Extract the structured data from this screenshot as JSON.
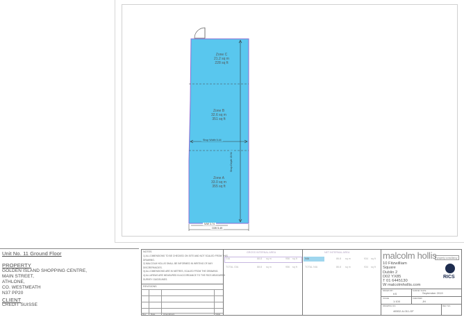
{
  "drawing": {
    "zones": [
      {
        "name": "Zone C",
        "sqm": "21.2 sq m",
        "sqft": "228 sq ft"
      },
      {
        "name": "Zone B",
        "sqm": "32.6 sq m",
        "sqft": "351 sq ft"
      },
      {
        "name": "Zone A",
        "sqm": "33.0 sq m",
        "sqft": "355 sq ft"
      }
    ],
    "shop_width": "Shop Width 5.44",
    "shop_depth": "Shop Depth 15.94",
    "dim_nw": "N/W 3.74",
    "dim_ow": "O/W 5.49"
  },
  "info": {
    "unit": "Unit No. 11 Ground Floor",
    "property_heading": "PROPERTY",
    "property_lines": [
      "GOLDEN ISLAND SHOPPING CENTRE,",
      "MAIN STREET,",
      "ATHLONE,",
      "CO. WESTMEATH",
      "N37 PP20"
    ],
    "client_heading": "CLIENT",
    "client": "CREDIT SUISSE"
  },
  "title_block": {
    "notes_heading": "NOTES",
    "notes": [
      "1) ALL DIMENSIONS TO BE CHECKED ON SITE AND NOT SCALED FROM THIS",
      "DRAWING.",
      "2) MALCOLM HOLLIS SHALL BE INFORMED IN WRITING OF ANY",
      "DISCREPANCIES.",
      "3) ALL DIMENSIONS ARE IN METRES, SCALED FROM THE DRAWING.",
      "4) ALL AREAS ARE MEASURED IN ACCORDANCE TO THE RICS MEASURED",
      "SURVEY GUIDELINES."
    ],
    "revisions_heading": "REVISIONS",
    "rev_cols": [
      "Rev",
      "Date",
      "Amendment",
      "Initial"
    ],
    "gia_heading": "GROSS INTERNAL AREA",
    "nia_heading": "NET INTERNAL AREA",
    "gia_rows": [
      [
        "GIA",
        "88.8",
        "sq m",
        "956",
        "sq ft"
      ],
      [
        "TOTAL GIA",
        "88.8",
        "sq m",
        "956",
        "sq ft"
      ]
    ],
    "nia_rows": [
      [
        "NIA",
        "86.8",
        "sq m",
        "934",
        "sq ft"
      ],
      [
        "TOTAL NIA",
        "86.8",
        "sq m",
        "934",
        "sq ft"
      ]
    ],
    "logo": "malcolm hollis",
    "logo_tag": "property consultancy",
    "address": [
      "10 Fitzwilliam",
      "Square",
      "Dublin 2",
      "D02 YX85"
    ],
    "tel": "T 01 6445130",
    "web": "W malcolmhollis.com",
    "rics": "RICS",
    "drawn_by_label": "DRAWN BY",
    "drawn_by": "KS",
    "date_label": "SURVEY DATE",
    "date": "September 2019",
    "scale_label": "SCALE",
    "scale": "1:100",
    "checked_label": "CHECKED",
    "checked": "JH",
    "drawing_no_label": "DRAWING NO.",
    "drawing_no": "46502-A-011-GF",
    "rev_no_label": "REV. NO.",
    "rev_no": ""
  }
}
